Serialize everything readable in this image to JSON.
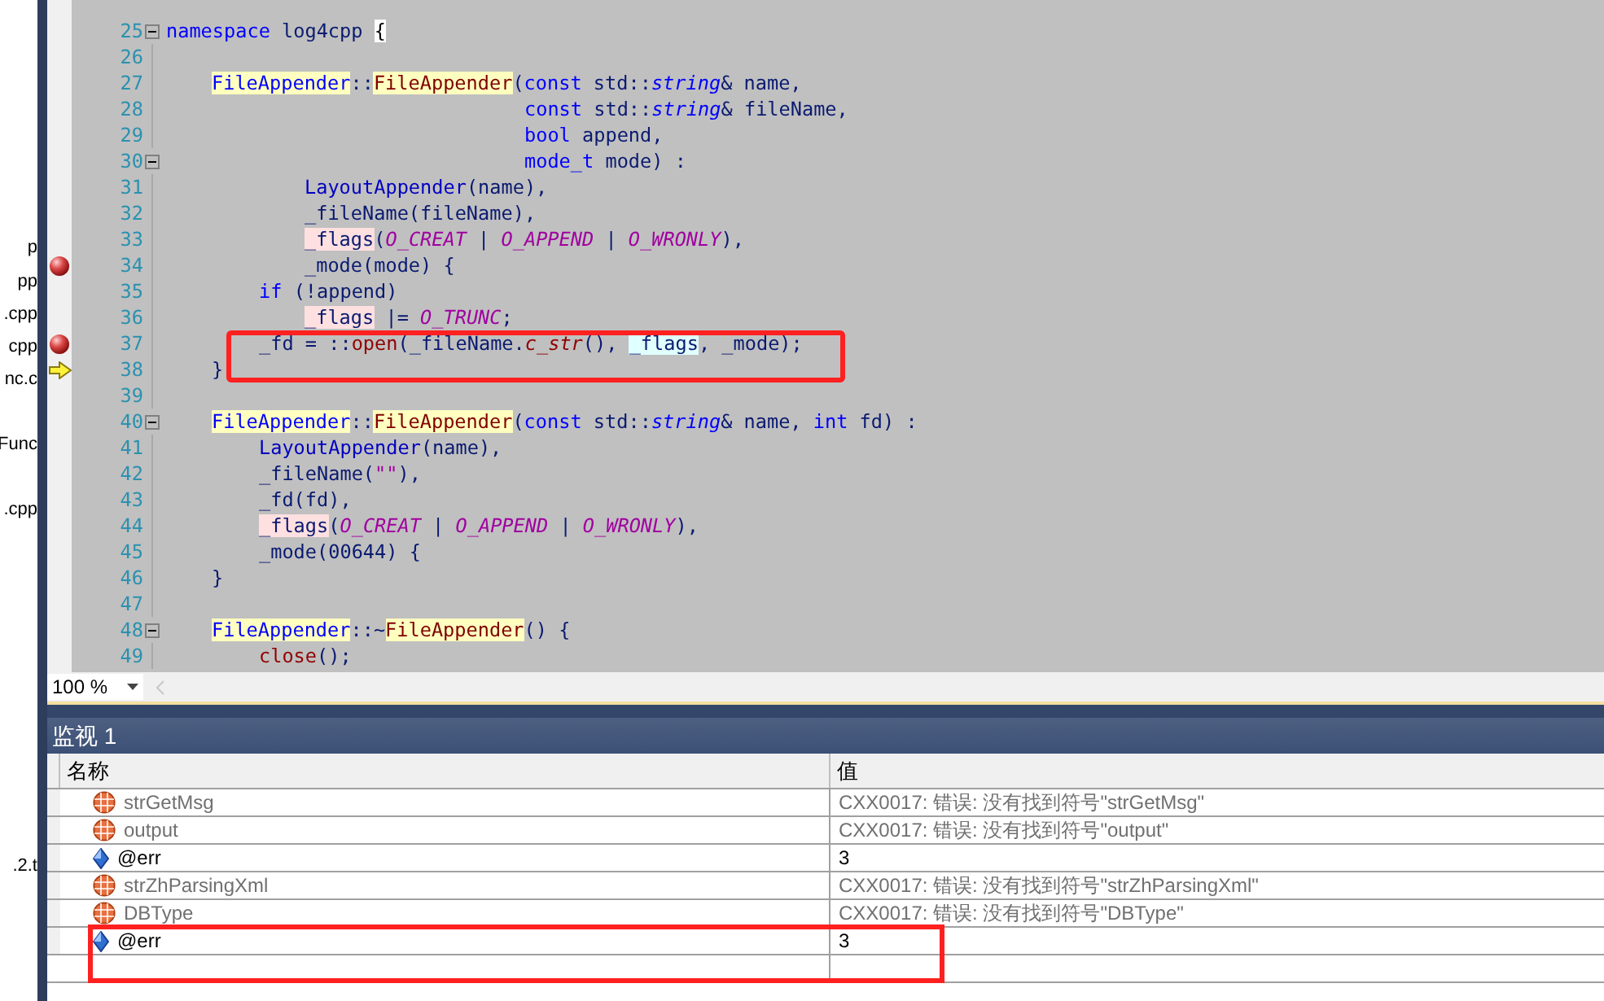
{
  "solution_explorer": {
    "items": [
      {
        "label": "p"
      },
      {
        "label": "pp"
      },
      {
        "label": ".cpp"
      },
      {
        "label": "cpp"
      },
      {
        "label": "nc.c"
      },
      {
        "label": "Func"
      },
      {
        "label": ".cpp"
      },
      {
        "label": ".2.t"
      }
    ]
  },
  "editor": {
    "lines": [
      {
        "number": "25",
        "fold": true,
        "breakpoint": false,
        "current": false,
        "boxed": false,
        "kind": "top",
        "tokens": [
          {
            "kind": "keyword",
            "text": "namespace"
          },
          {
            "kind": "plain",
            "text": " log4cpp "
          },
          {
            "kind": "brace",
            "text": "{"
          }
        ]
      },
      {
        "number": "26",
        "fold": false,
        "breakpoint": false,
        "current": false,
        "boxed": false,
        "kind": "blank"
      },
      {
        "number": "27",
        "fold": false,
        "breakpoint": false,
        "current": false,
        "boxed": false,
        "kind": "member",
        "tokens": [
          {
            "kind": "class",
            "text": "FileAppender"
          },
          {
            "kind": "plain",
            "text": "::"
          },
          {
            "kind": "ctor",
            "text": "FileAppender"
          },
          {
            "kind": "plain",
            "text": "("
          },
          {
            "kind": "keyword",
            "text": "const"
          },
          {
            "kind": "plain",
            "text": " std::"
          },
          {
            "kind": "type",
            "text": "string"
          },
          {
            "kind": "plain",
            "text": "& name,"
          }
        ]
      },
      {
        "number": "28",
        "fold": false,
        "breakpoint": false,
        "current": false,
        "boxed": false,
        "kind": "parameter",
        "tokens": [
          {
            "kind": "keyword",
            "text": "const"
          },
          {
            "kind": "plain",
            "text": " std::"
          },
          {
            "kind": "type",
            "text": "string"
          },
          {
            "kind": "plain",
            "text": "& fileName,"
          }
        ]
      },
      {
        "number": "29",
        "fold": false,
        "breakpoint": false,
        "current": false,
        "boxed": false,
        "kind": "parameter",
        "tokens": [
          {
            "kind": "keyword",
            "text": "bool"
          },
          {
            "kind": "plain",
            "text": " append,"
          }
        ]
      },
      {
        "number": "30",
        "fold": true,
        "breakpoint": false,
        "current": false,
        "boxed": false,
        "kind": "parameter",
        "tokens": [
          {
            "kind": "keyword",
            "text": "mode_t"
          },
          {
            "kind": "plain",
            "text": " mode) :"
          }
        ]
      },
      {
        "number": "31",
        "fold": false,
        "breakpoint": false,
        "current": false,
        "boxed": false,
        "kind": "initializer",
        "tokens": [
          {
            "kind": "base",
            "text": "LayoutAppender"
          },
          {
            "kind": "plain",
            "text": "(name),"
          }
        ]
      },
      {
        "number": "32",
        "fold": false,
        "breakpoint": false,
        "current": false,
        "boxed": false,
        "kind": "initializer",
        "tokens": [
          {
            "kind": "plain",
            "text": "_fileName(fileName),"
          }
        ]
      },
      {
        "number": "33",
        "fold": false,
        "breakpoint": false,
        "current": false,
        "boxed": false,
        "kind": "initializer",
        "tokens": [
          {
            "kind": "member",
            "text": "_flags"
          },
          {
            "kind": "plain",
            "text": "("
          },
          {
            "kind": "macro",
            "text": "O_CREAT"
          },
          {
            "kind": "plain",
            "text": " | "
          },
          {
            "kind": "macro",
            "text": "O_APPEND"
          },
          {
            "kind": "plain",
            "text": " | "
          },
          {
            "kind": "macro",
            "text": "O_WRONLY"
          },
          {
            "kind": "plain",
            "text": "),"
          }
        ]
      },
      {
        "number": "34",
        "fold": false,
        "breakpoint": true,
        "current": false,
        "boxed": false,
        "kind": "initializer",
        "tokens": [
          {
            "kind": "plain",
            "text": "_mode(mode) {"
          }
        ]
      },
      {
        "number": "35",
        "fold": false,
        "breakpoint": false,
        "current": false,
        "boxed": false,
        "kind": "body",
        "tokens": [
          {
            "kind": "keyword",
            "text": "if"
          },
          {
            "kind": "plain",
            "text": " (!append)"
          }
        ]
      },
      {
        "number": "36",
        "fold": false,
        "breakpoint": false,
        "current": false,
        "boxed": false,
        "kind": "initializer",
        "tokens": [
          {
            "kind": "member",
            "text": "_flags"
          },
          {
            "kind": "plain",
            "text": " |= "
          },
          {
            "kind": "macro",
            "text": "O_TRUNC"
          },
          {
            "kind": "plain",
            "text": ";"
          }
        ]
      },
      {
        "number": "37",
        "fold": false,
        "breakpoint": true,
        "current": false,
        "boxed": true,
        "kind": "body",
        "tokens": [
          {
            "kind": "plain",
            "text": "_fd = ::"
          },
          {
            "kind": "func",
            "text": "open"
          },
          {
            "kind": "plain",
            "text": "(_fileName."
          },
          {
            "kind": "method",
            "text": "c_str"
          },
          {
            "kind": "plain",
            "text": "(), "
          },
          {
            "kind": "reference",
            "text": "_flags"
          },
          {
            "kind": "plain",
            "text": ", _mode);"
          }
        ]
      },
      {
        "number": "38",
        "fold": false,
        "breakpoint": false,
        "current": true,
        "boxed": false,
        "kind": "member",
        "tokens": [
          {
            "kind": "plain",
            "text": "}"
          }
        ]
      },
      {
        "number": "39",
        "fold": false,
        "breakpoint": false,
        "current": false,
        "boxed": false,
        "kind": "blank"
      },
      {
        "number": "40",
        "fold": true,
        "breakpoint": false,
        "current": false,
        "boxed": false,
        "kind": "member",
        "tokens": [
          {
            "kind": "class",
            "text": "FileAppender"
          },
          {
            "kind": "plain",
            "text": "::"
          },
          {
            "kind": "ctor",
            "text": "FileAppender"
          },
          {
            "kind": "plain",
            "text": "("
          },
          {
            "kind": "keyword",
            "text": "const"
          },
          {
            "kind": "plain",
            "text": " std::"
          },
          {
            "kind": "type",
            "text": "string"
          },
          {
            "kind": "plain",
            "text": "& name, "
          },
          {
            "kind": "keyword",
            "text": "int"
          },
          {
            "kind": "plain",
            "text": " fd) :"
          }
        ]
      },
      {
        "number": "41",
        "fold": false,
        "breakpoint": false,
        "current": false,
        "boxed": false,
        "kind": "body",
        "tokens": [
          {
            "kind": "base",
            "text": "LayoutAppender"
          },
          {
            "kind": "plain",
            "text": "(name),"
          }
        ]
      },
      {
        "number": "42",
        "fold": false,
        "breakpoint": false,
        "current": false,
        "boxed": false,
        "kind": "body",
        "tokens": [
          {
            "kind": "plain",
            "text": "_fileName("
          },
          {
            "kind": "string",
            "text": "\"\""
          },
          {
            "kind": "plain",
            "text": "),"
          }
        ]
      },
      {
        "number": "43",
        "fold": false,
        "breakpoint": false,
        "current": false,
        "boxed": false,
        "kind": "body",
        "tokens": [
          {
            "kind": "plain",
            "text": "_fd(fd),"
          }
        ]
      },
      {
        "number": "44",
        "fold": false,
        "breakpoint": false,
        "current": false,
        "boxed": false,
        "kind": "body",
        "tokens": [
          {
            "kind": "member",
            "text": "_flags"
          },
          {
            "kind": "plain",
            "text": "("
          },
          {
            "kind": "macro",
            "text": "O_CREAT"
          },
          {
            "kind": "plain",
            "text": " | "
          },
          {
            "kind": "macro",
            "text": "O_APPEND"
          },
          {
            "kind": "plain",
            "text": " | "
          },
          {
            "kind": "macro",
            "text": "O_WRONLY"
          },
          {
            "kind": "plain",
            "text": "),"
          }
        ]
      },
      {
        "number": "45",
        "fold": false,
        "breakpoint": false,
        "current": false,
        "boxed": false,
        "kind": "body",
        "tokens": [
          {
            "kind": "plain",
            "text": "_mode(00644) {"
          }
        ]
      },
      {
        "number": "46",
        "fold": false,
        "breakpoint": false,
        "current": false,
        "boxed": false,
        "kind": "member",
        "tokens": [
          {
            "kind": "plain",
            "text": "}"
          }
        ]
      },
      {
        "number": "47",
        "fold": false,
        "breakpoint": false,
        "current": false,
        "boxed": false,
        "kind": "blank"
      },
      {
        "number": "48",
        "fold": true,
        "breakpoint": false,
        "current": false,
        "boxed": false,
        "kind": "member",
        "tokens": [
          {
            "kind": "class",
            "text": "FileAppender"
          },
          {
            "kind": "plain",
            "text": "::~"
          },
          {
            "kind": "ctor",
            "text": "FileAppender"
          },
          {
            "kind": "plain",
            "text": "() {"
          }
        ]
      },
      {
        "number": "49",
        "fold": false,
        "breakpoint": false,
        "current": false,
        "boxed": false,
        "kind": "body",
        "tokens": [
          {
            "kind": "func",
            "text": "close"
          },
          {
            "kind": "plain",
            "text": "();"
          }
        ]
      }
    ],
    "zoom": "100 %"
  },
  "watch": {
    "title": "监视 1",
    "columns": [
      "名称",
      "值"
    ],
    "rows": [
      {
        "name": "strGetMsg",
        "value": "CXX0017: 错误: 没有找到符号\"strGetMsg\"",
        "kind": "error",
        "boxed": false
      },
      {
        "name": "output",
        "value": "CXX0017: 错误: 没有找到符号\"output\"",
        "kind": "error",
        "boxed": false
      },
      {
        "name": "@err",
        "value": "3",
        "kind": "ok",
        "boxed": false
      },
      {
        "name": "strZhParsingXml",
        "value": "CXX0017: 错误: 没有找到符号\"strZhParsingXml\"",
        "kind": "error",
        "boxed": false
      },
      {
        "name": "DBType",
        "value": "CXX0017: 错误: 没有找到符号\"DBType\"",
        "kind": "error",
        "boxed": false
      },
      {
        "name": "@err",
        "value": "3",
        "kind": "ok",
        "boxed": true
      }
    ]
  }
}
